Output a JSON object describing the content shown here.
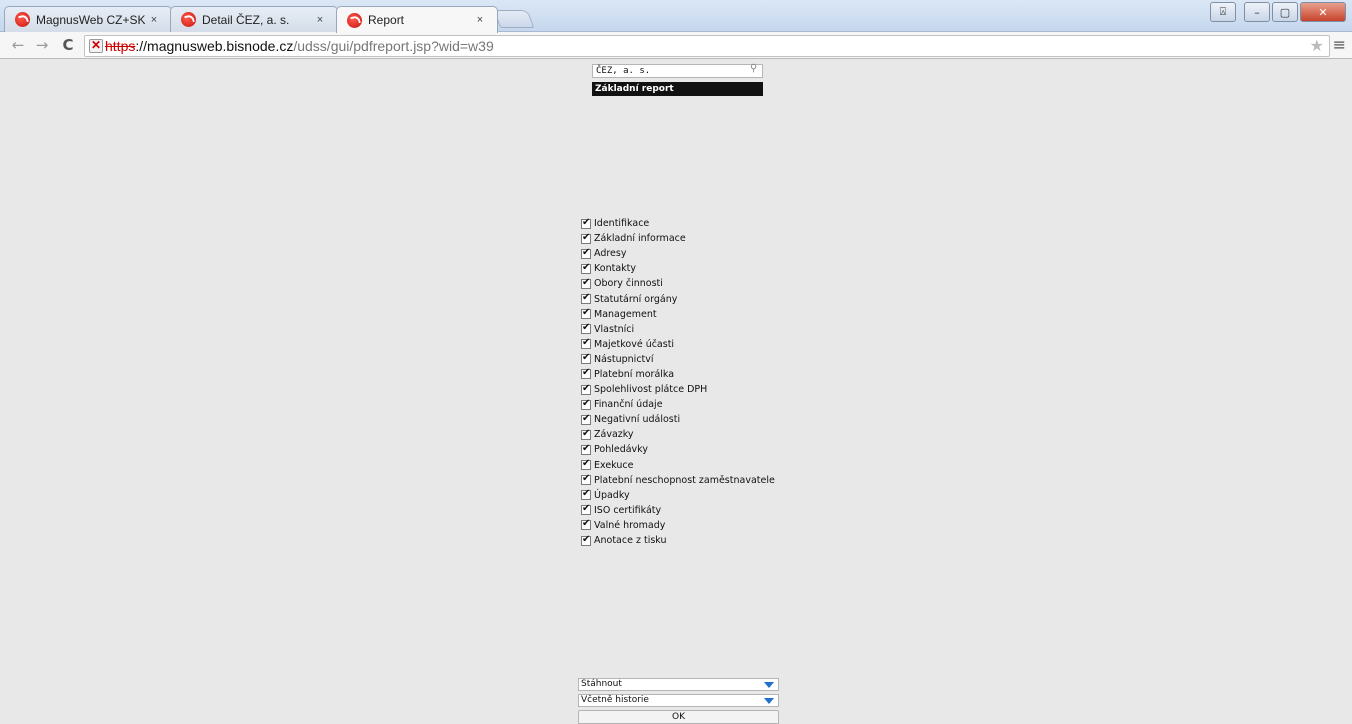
{
  "browser": {
    "tabs": [
      {
        "title": "MagnusWeb CZ+SK",
        "close": "×"
      },
      {
        "title": "Detail ČEZ, a. s.",
        "close": "×"
      },
      {
        "title": "Report",
        "close": "×"
      }
    ],
    "address": {
      "scheme": "https",
      "host": "://magnusweb.bisnode.cz",
      "path": "/udss/gui/pdfreport.jsp?wid=w39"
    },
    "nav": {
      "back": "←",
      "forward": "→",
      "reload": "C"
    },
    "icons": {
      "star": "★",
      "menu": "≡"
    },
    "window": {
      "minimize": "–",
      "maximize": "▢",
      "close": "✕",
      "user": "⍓"
    }
  },
  "report": {
    "company": "ČEZ, a. s.",
    "search_icon": "⚲",
    "report_type": "Základní report",
    "sections": [
      {
        "label": "Identifikace",
        "checked": true
      },
      {
        "label": "Základní informace",
        "checked": true
      },
      {
        "label": "Adresy",
        "checked": true
      },
      {
        "label": "Kontakty",
        "checked": true
      },
      {
        "label": "Obory činnosti",
        "checked": true
      },
      {
        "label": "Statutární orgány",
        "checked": true
      },
      {
        "label": "Management",
        "checked": true
      },
      {
        "label": "Vlastníci",
        "checked": true
      },
      {
        "label": "Majetkové účasti",
        "checked": true
      },
      {
        "label": "Nástupnictví",
        "checked": true
      },
      {
        "label": "Platební morálka",
        "checked": true
      },
      {
        "label": "Spolehlivost plátce DPH",
        "checked": true
      },
      {
        "label": "Finanční údaje",
        "checked": true
      },
      {
        "label": "Negativní události",
        "checked": true
      },
      {
        "label": "Závazky",
        "checked": true
      },
      {
        "label": "Pohledávky",
        "checked": true
      },
      {
        "label": "Exekuce",
        "checked": true
      },
      {
        "label": "Platební neschopnost zaměstnavatele",
        "checked": true
      },
      {
        "label": "Úpadky",
        "checked": true
      },
      {
        "label": "ISO certifikáty",
        "checked": true
      },
      {
        "label": "Valné hromady",
        "checked": true
      },
      {
        "label": "Anotace z tisku",
        "checked": true
      }
    ],
    "output_select": "Stáhnout",
    "history_select": "Včetně historie",
    "ok_label": "OK"
  }
}
